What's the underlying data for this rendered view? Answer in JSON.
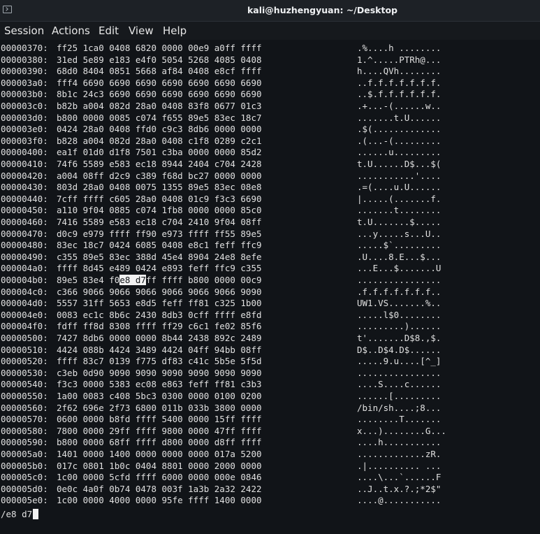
{
  "window": {
    "icon": "terminal-icon",
    "title": "kali@huzhengyuan: ~/Desktop"
  },
  "menu": [
    "Session",
    "Actions",
    "Edit",
    "View",
    "Help"
  ],
  "rows": [
    {
      "offset": "00000370:",
      "hex": "ff25 1ca0 0408 6820 0000 00e9 a0ff ffff",
      "ascii": ".%....h ........"
    },
    {
      "offset": "00000380:",
      "hex": "31ed 5e89 e183 e4f0 5054 5268 4085 0408",
      "ascii": "1.^.....PTRh@..."
    },
    {
      "offset": "00000390:",
      "hex": "68d0 8404 0851 5668 af84 0408 e8cf ffff",
      "ascii": "h....QVh........"
    },
    {
      "offset": "000003a0:",
      "hex": "fff4 6690 6690 6690 6690 6690 6690 6690",
      "ascii": "..f.f.f.f.f.f.f."
    },
    {
      "offset": "000003b0:",
      "hex": "8b1c 24c3 6690 6690 6690 6690 6690 6690",
      "ascii": "..$.f.f.f.f.f.f."
    },
    {
      "offset": "000003c0:",
      "hex": "b82b a004 082d 28a0 0408 83f8 0677 01c3",
      "ascii": ".+...-(......w.."
    },
    {
      "offset": "000003d0:",
      "hex": "b800 0000 0085 c074 f655 89e5 83ec 18c7",
      "ascii": ".......t.U......"
    },
    {
      "offset": "000003e0:",
      "hex": "0424 28a0 0408 ffd0 c9c3 8db6 0000 0000",
      "ascii": ".$(............."
    },
    {
      "offset": "000003f0:",
      "hex": "b828 a004 082d 28a0 0408 c1f8 0289 c2c1",
      "ascii": ".(...-(........."
    },
    {
      "offset": "00000400:",
      "hex": "ea1f 01d0 d1f8 7501 c3ba 0000 0000 85d2",
      "ascii": "......u........."
    },
    {
      "offset": "00000410:",
      "hex": "74f6 5589 e583 ec18 8944 2404 c704 2428",
      "ascii": "t.U......D$...$("
    },
    {
      "offset": "00000420:",
      "hex": "a004 08ff d2c9 c389 f68d bc27 0000 0000",
      "ascii": "...........'...."
    },
    {
      "offset": "00000430:",
      "hex": "803d 28a0 0408 0075 1355 89e5 83ec 08e8",
      "ascii": ".=(....u.U......"
    },
    {
      "offset": "00000440:",
      "hex": "7cff ffff c605 28a0 0408 01c9 f3c3 6690",
      "ascii": "|.....(.......f."
    },
    {
      "offset": "00000450:",
      "hex": "a110 9f04 0885 c074 1fb8 0000 0000 85c0",
      "ascii": ".......t........"
    },
    {
      "offset": "00000460:",
      "hex": "7416 5589 e583 ec18 c704 2410 9f04 08ff",
      "ascii": "t.U.......$....."
    },
    {
      "offset": "00000470:",
      "hex": "d0c9 e979 ffff ff90 e973 ffff ff55 89e5",
      "ascii": "...y.....s...U.."
    },
    {
      "offset": "00000480:",
      "hex": "83ec 18c7 0424 6085 0408 e8c1 feff ffc9",
      "ascii": ".....$`........."
    },
    {
      "offset": "00000490:",
      "hex": "c355 89e5 83ec 388d 45e4 8904 24e8 8efe",
      "ascii": ".U....8.E...$..."
    },
    {
      "offset": "000004a0:",
      "hex": "ffff 8d45 e489 0424 e893 feff ffc9 c355",
      "ascii": "...E...$.......U"
    },
    {
      "offset": "000004b0:",
      "hex": "89e5 83e4 f0e8 d7ff ffff b800 0000 00c9",
      "ascii": "................",
      "match": "e8 d7"
    },
    {
      "offset": "000004c0:",
      "hex": "c366 9066 9066 9066 9066 9066 9066 9090",
      "ascii": ".f.f.f.f.f.f.f.."
    },
    {
      "offset": "000004d0:",
      "hex": "5557 31ff 5653 e8d5 feff ff81 c325 1b00",
      "ascii": "UW1.VS.......%.."
    },
    {
      "offset": "000004e0:",
      "hex": "0083 ec1c 8b6c 2430 8db3 0cff ffff e8fd",
      "ascii": ".....l$0........"
    },
    {
      "offset": "000004f0:",
      "hex": "fdff ff8d 8308 ffff ff29 c6c1 fe02 85f6",
      "ascii": ".........)......"
    },
    {
      "offset": "00000500:",
      "hex": "7427 8db6 0000 0000 8b44 2438 892c 2489",
      "ascii": "t'.......D$8.,$."
    },
    {
      "offset": "00000510:",
      "hex": "4424 088b 4424 3489 4424 04ff 94bb 08ff",
      "ascii": "D$..D$4.D$......"
    },
    {
      "offset": "00000520:",
      "hex": "ffff 83c7 0139 f775 df83 c41c 5b5e 5f5d",
      "ascii": ".....9.u....[^_]"
    },
    {
      "offset": "00000530:",
      "hex": "c3eb 0d90 9090 9090 9090 9090 9090 9090",
      "ascii": "................"
    },
    {
      "offset": "00000540:",
      "hex": "f3c3 0000 5383 ec08 e863 feff ff81 c3b3",
      "ascii": "....S....c......"
    },
    {
      "offset": "00000550:",
      "hex": "1a00 0083 c408 5bc3 0300 0000 0100 0200",
      "ascii": "......[........."
    },
    {
      "offset": "00000560:",
      "hex": "2f62 696e 2f73 6800 011b 033b 3800 0000",
      "ascii": "/bin/sh....;8..."
    },
    {
      "offset": "00000570:",
      "hex": "0600 0000 b8fd ffff 5400 0000 15ff ffff",
      "ascii": "........T......."
    },
    {
      "offset": "00000580:",
      "hex": "7800 0000 29ff ffff 9800 0000 47ff ffff",
      "ascii": "x...)........G..."
    },
    {
      "offset": "00000590:",
      "hex": "b800 0000 68ff ffff d800 0000 d8ff ffff",
      "ascii": "....h..........."
    },
    {
      "offset": "000005a0:",
      "hex": "1401 0000 1400 0000 0000 0000 017a 5200",
      "ascii": ".............zR."
    },
    {
      "offset": "000005b0:",
      "hex": "017c 0801 1b0c 0404 8801 0000 2000 0000",
      "ascii": ".|.......... ..."
    },
    {
      "offset": "000005c0:",
      "hex": "1c00 0000 5cfd ffff 6000 0000 000e 0846",
      "ascii": "....\\...`......F"
    },
    {
      "offset": "000005d0:",
      "hex": "0e0c 4a0f 0b74 0478 003f 1a3b 2a32 2422",
      "ascii": "..J..t.x.?.;*2$\""
    },
    {
      "offset": "000005e0:",
      "hex": "1c00 0000 4000 0000 95fe ffff 1400 0000",
      "ascii": "....@..........."
    }
  ],
  "prompt": {
    "text": "/e8 d7"
  }
}
